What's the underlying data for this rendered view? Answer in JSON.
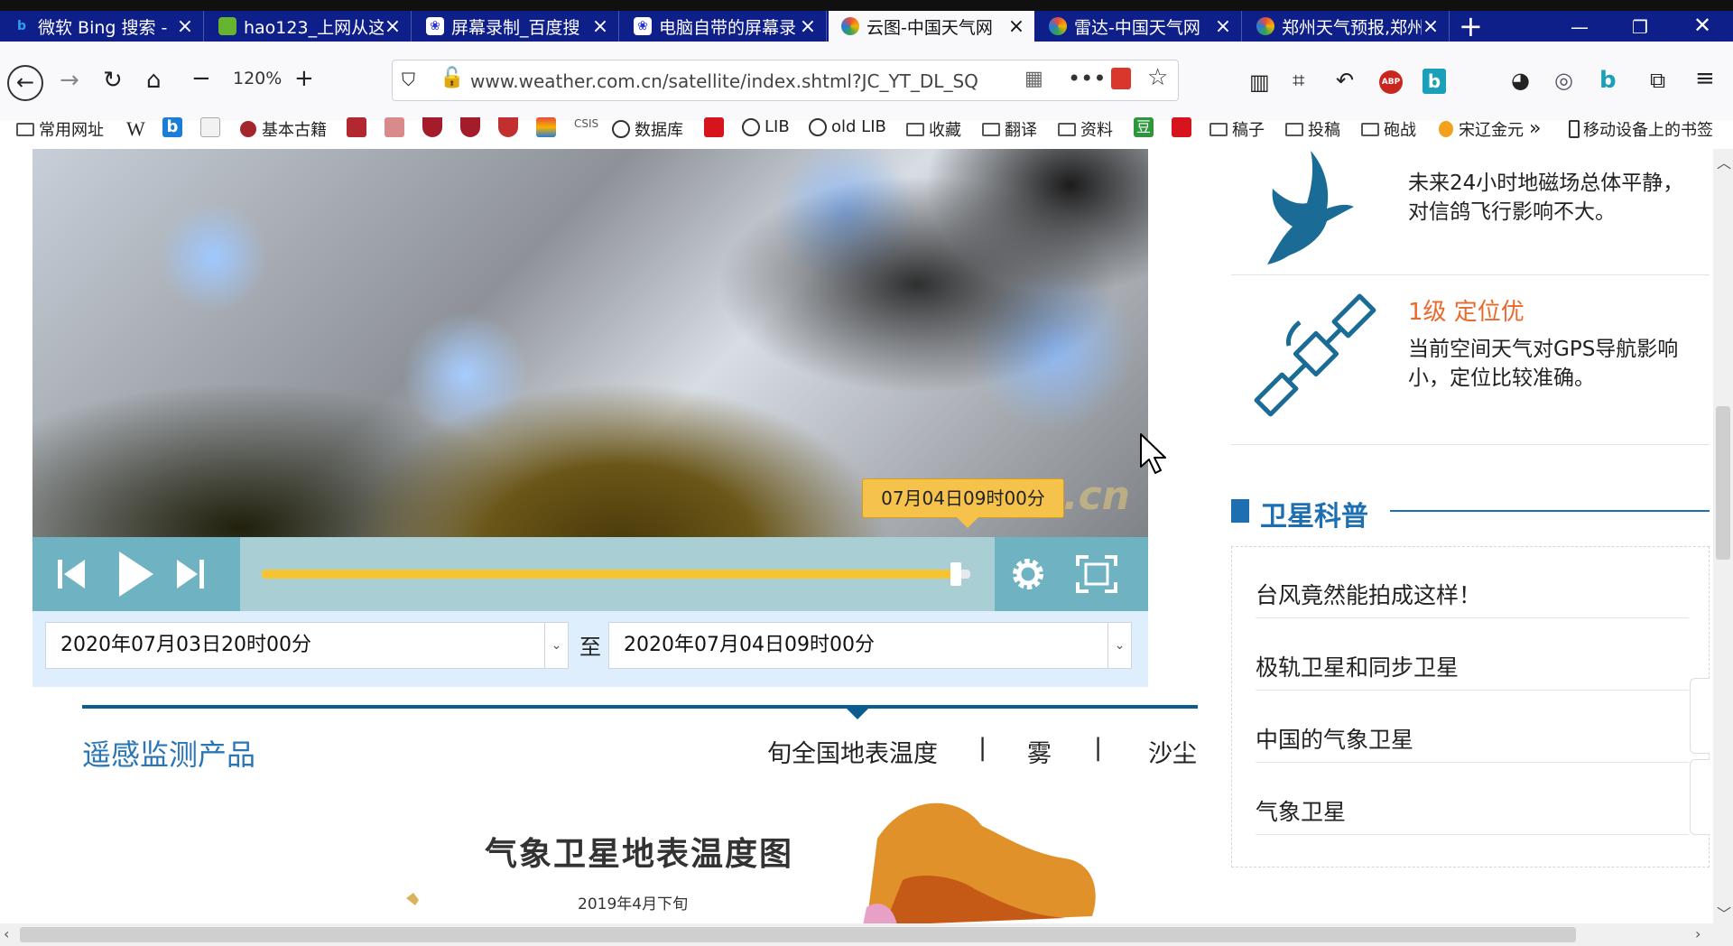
{
  "tabs": [
    {
      "title": "微软 Bing 搜索 -",
      "icon": "bing-icon"
    },
    {
      "title": "hao123_上网从这",
      "icon": "hao123-icon"
    },
    {
      "title": "屏幕录制_百度搜",
      "icon": "baidu-paw-icon"
    },
    {
      "title": "电脑自带的屏幕录",
      "icon": "baidu-paw-icon"
    },
    {
      "title": "云图-中国天气网",
      "icon": "weather-swirl-icon",
      "active": true
    },
    {
      "title": "雷达-中国天气网",
      "icon": "weather-swirl-icon"
    },
    {
      "title": "郑州天气预报,郑州",
      "icon": "weather-swirl-icon"
    }
  ],
  "nav": {
    "zoom": "120%",
    "url": "www.weather.com.cn/satellite/index.shtml?JC_YT_DL_SQ"
  },
  "bookmarks": [
    {
      "label": "常用网址",
      "type": "folder"
    },
    {
      "label": "W",
      "type": "text"
    },
    {
      "label": "",
      "type": "bing"
    },
    {
      "label": "",
      "type": "doc"
    },
    {
      "label": "基本古籍",
      "type": "site"
    },
    {
      "label": "",
      "type": "red"
    },
    {
      "label": "",
      "type": "red"
    },
    {
      "label": "",
      "type": "shield"
    },
    {
      "label": "",
      "type": "shield"
    },
    {
      "label": "",
      "type": "shield"
    },
    {
      "label": "",
      "type": "color"
    },
    {
      "label": "CSIS",
      "type": "small"
    },
    {
      "label": "数据库",
      "type": "globe"
    },
    {
      "label": "",
      "type": "red"
    },
    {
      "label": "LIB",
      "type": "globe"
    },
    {
      "label": "old LIB",
      "type": "globe"
    },
    {
      "label": "收藏",
      "type": "folder"
    },
    {
      "label": "翻译",
      "type": "folder"
    },
    {
      "label": "资料",
      "type": "folder"
    },
    {
      "label": "",
      "type": "douban"
    },
    {
      "label": "",
      "type": "red"
    },
    {
      "label": "稿子",
      "type": "folder"
    },
    {
      "label": "投稿",
      "type": "folder"
    },
    {
      "label": "砲战",
      "type": "folder"
    },
    {
      "label": "宋辽金元",
      "type": "site"
    },
    {
      "label": "移动设备上的书签",
      "type": "mobile"
    }
  ],
  "player": {
    "time_tip": "07月04日09时00分",
    "watermark": "n.cn",
    "progress": 0.98,
    "start_date": "2020年07月03日20时00分",
    "end_date": "2020年07月04日09时00分",
    "to_label": "至"
  },
  "remote": {
    "title": "遥感监测产品",
    "links": [
      "旬全国地表温度",
      "|",
      "雾",
      "|",
      "沙尘"
    ],
    "map_title": "气象卫星地表温度图",
    "map_subtitle": "2019年4月下旬"
  },
  "sidebar": {
    "pigeon_text_1": "未来24小时地磁场总体平静，",
    "pigeon_text_2": "对信鸽飞行影响不大。",
    "gps_level": "1级 定位优",
    "gps_text_1": "当前空间天气对GPS导航影响",
    "gps_text_2": "小，定位比较准确。",
    "section_title": "卫星科普",
    "articles": [
      "台风竟然能拍成这样！",
      "极轨卫星和同步卫星",
      "中国的气象卫星",
      "气象卫星"
    ]
  },
  "colors": {
    "tabbar": "#0f1f8a",
    "player_bar": "#6fb2c2",
    "progress": "#f5c430",
    "brand_blue": "#1d6fb1",
    "accent_orange": "#e96a2c"
  }
}
